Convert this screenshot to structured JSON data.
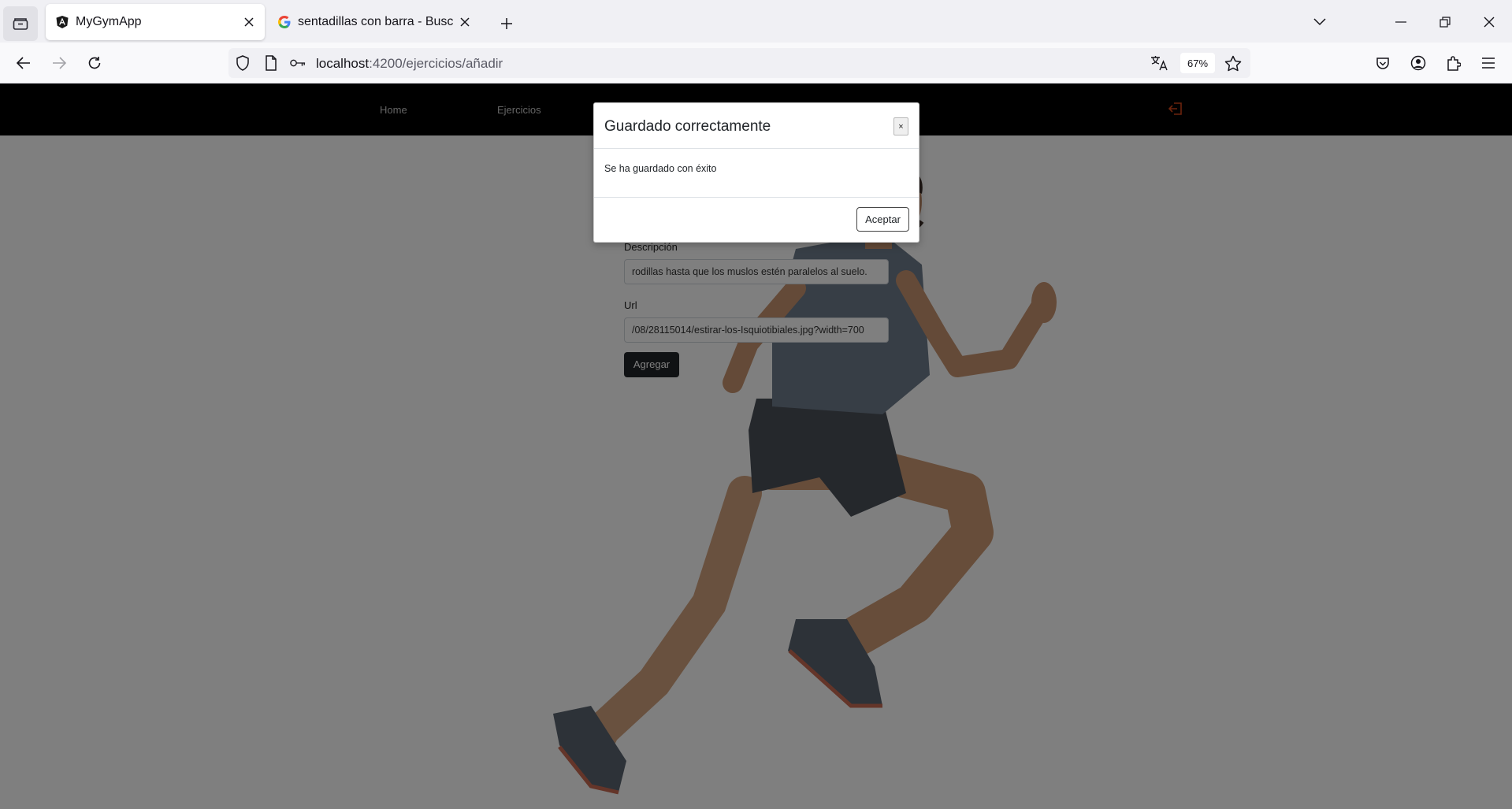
{
  "browser": {
    "tabs": [
      {
        "title": "MyGymApp",
        "active": true,
        "favicon": "angular-icon"
      },
      {
        "title": "sentadillas con barra - Buscar co",
        "active": false,
        "favicon": "google-icon"
      }
    ],
    "url": {
      "host": "localhost",
      "path": ":4200/ejercicios/añadir"
    },
    "zoom": "67%"
  },
  "app_nav": {
    "links": [
      {
        "label": "Home"
      },
      {
        "label": "Ejercicios"
      }
    ],
    "logout_icon_color": "#d9481a"
  },
  "form": {
    "description_label": "Descripción",
    "description_value": "rodillas hasta que los muslos estén paralelos al suelo.",
    "url_label": "Url",
    "url_value": "/08/28115014/estirar-los-Isquiotibiales.jpg?width=700",
    "submit_label": "Agregar"
  },
  "modal": {
    "title": "Guardado correctamente",
    "close_label": "×",
    "body": "Se ha guardado con éxito",
    "accept_label": "Aceptar"
  }
}
